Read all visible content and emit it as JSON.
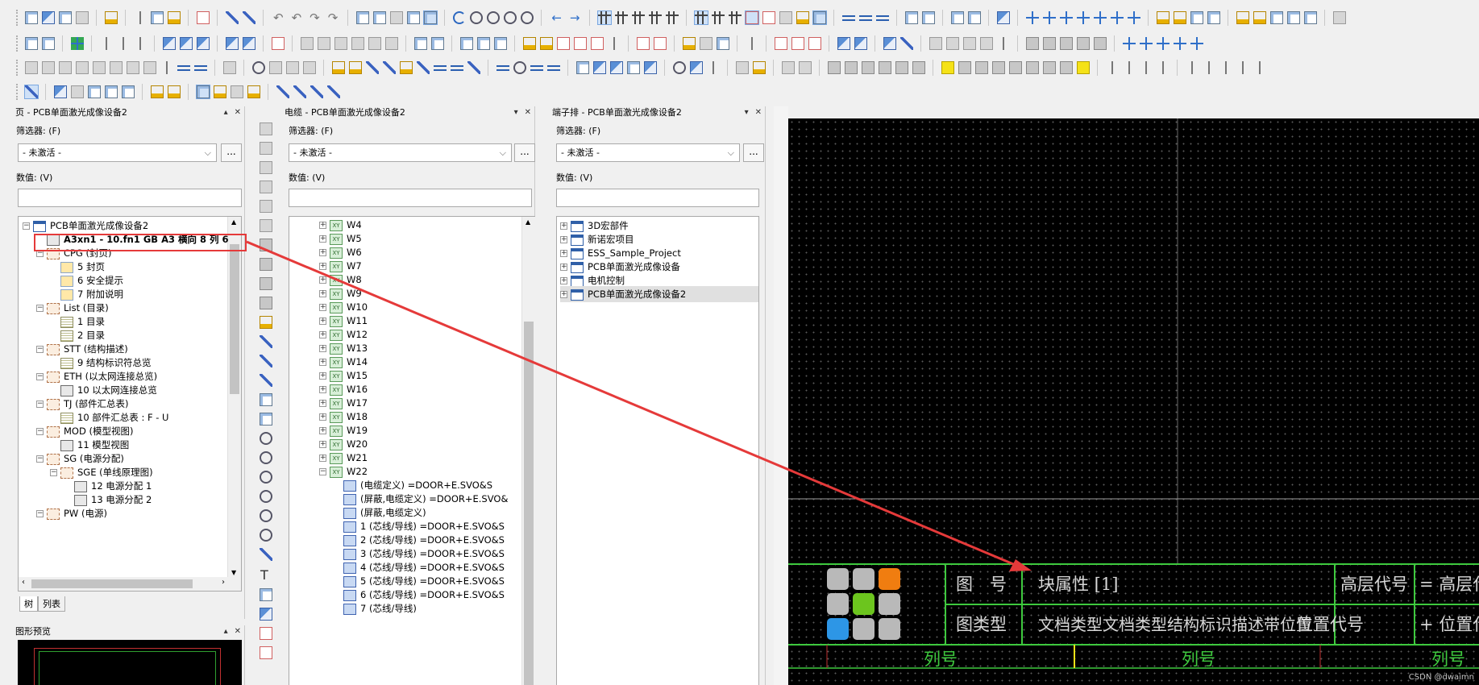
{
  "pages_panel": {
    "title": "页 - PCB单面激光成像设备2",
    "filter_label": "筛选器: (F)",
    "filter_value": "- 未激活 -",
    "value_label": "数值: (V)",
    "more_button": "...",
    "tree": [
      {
        "text": "PCB单面激光成像设备2",
        "level": 0,
        "icon": "proj",
        "exp": "−"
      },
      {
        "text": "A3xn1 - 10.fn1 GB A3 横向 8 列 6",
        "level": 1,
        "icon": "pg",
        "bold": true
      },
      {
        "text": "CPG (封页)",
        "level": 1,
        "icon": "grp",
        "exp": "−"
      },
      {
        "text": "5 封页",
        "level": 2,
        "icon": "sheet"
      },
      {
        "text": "6 安全提示",
        "level": 2,
        "icon": "sheet"
      },
      {
        "text": "7 附加说明",
        "level": 2,
        "icon": "sheet"
      },
      {
        "text": "List (目录)",
        "level": 1,
        "icon": "grp",
        "exp": "−"
      },
      {
        "text": "1 目录",
        "level": 2,
        "icon": "list"
      },
      {
        "text": "2 目录",
        "level": 2,
        "icon": "list"
      },
      {
        "text": "STT (结构描述)",
        "level": 1,
        "icon": "grp",
        "exp": "−"
      },
      {
        "text": "9 结构标识符总览",
        "level": 2,
        "icon": "list"
      },
      {
        "text": "ETH (以太网连接总览)",
        "level": 1,
        "icon": "grp",
        "exp": "−"
      },
      {
        "text": "10 以太网连接总览",
        "level": 2,
        "icon": "pg"
      },
      {
        "text": "TJ (部件汇总表)",
        "level": 1,
        "icon": "grp",
        "exp": "−"
      },
      {
        "text": "10 部件汇总表 : F - U",
        "level": 2,
        "icon": "list"
      },
      {
        "text": "MOD (模型视图)",
        "level": 1,
        "icon": "grp",
        "exp": "−"
      },
      {
        "text": "11 模型视图",
        "level": 2,
        "icon": "pg"
      },
      {
        "text": "SG (电源分配)",
        "level": 1,
        "icon": "grp",
        "exp": "−"
      },
      {
        "text": "SGE (单线原理图)",
        "level": 2,
        "icon": "grp",
        "exp": "−"
      },
      {
        "text": "12 电源分配 1",
        "level": 3,
        "icon": "pg"
      },
      {
        "text": "13 电源分配 2",
        "level": 3,
        "icon": "pg"
      },
      {
        "text": "PW (电源)",
        "level": 1,
        "icon": "grp",
        "exp": "−"
      }
    ],
    "tabs": [
      "树",
      "列表"
    ]
  },
  "preview_panel": {
    "title": "图形预览"
  },
  "cables_panel": {
    "title": "电缆 - PCB单面激光成像设备2",
    "filter_label": "筛选器: (F)",
    "filter_value": "- 未激活 -",
    "value_label": "数值: (V)",
    "more_button": "...",
    "tree": [
      {
        "text": "W4",
        "level": 0,
        "icon": "cab",
        "exp": "+"
      },
      {
        "text": "W5",
        "level": 0,
        "icon": "cab",
        "exp": "+"
      },
      {
        "text": "W6",
        "level": 0,
        "icon": "cab",
        "exp": "+"
      },
      {
        "text": "W7",
        "level": 0,
        "icon": "cab",
        "exp": "+"
      },
      {
        "text": "W8",
        "level": 0,
        "icon": "cab",
        "exp": "+"
      },
      {
        "text": "W9",
        "level": 0,
        "icon": "cab",
        "exp": "+"
      },
      {
        "text": "W10",
        "level": 0,
        "icon": "cab",
        "exp": "+"
      },
      {
        "text": "W11",
        "level": 0,
        "icon": "cab",
        "exp": "+"
      },
      {
        "text": "W12",
        "level": 0,
        "icon": "cab",
        "exp": "+"
      },
      {
        "text": "W13",
        "level": 0,
        "icon": "cab",
        "exp": "+"
      },
      {
        "text": "W14",
        "level": 0,
        "icon": "cab",
        "exp": "+"
      },
      {
        "text": "W15",
        "level": 0,
        "icon": "cab",
        "exp": "+"
      },
      {
        "text": "W16",
        "level": 0,
        "icon": "cab",
        "exp": "+"
      },
      {
        "text": "W17",
        "level": 0,
        "icon": "cab",
        "exp": "+"
      },
      {
        "text": "W18",
        "level": 0,
        "icon": "cab",
        "exp": "+"
      },
      {
        "text": "W19",
        "level": 0,
        "icon": "cab",
        "exp": "+"
      },
      {
        "text": "W20",
        "level": 0,
        "icon": "cab",
        "exp": "+"
      },
      {
        "text": "W21",
        "level": 0,
        "icon": "cab",
        "exp": "+"
      },
      {
        "text": "W22",
        "level": 0,
        "icon": "cab",
        "exp": "−"
      },
      {
        "text": "(电缆定义) =DOOR+E.SVO&S",
        "level": 1,
        "icon": "wire"
      },
      {
        "text": "(屏蔽,电缆定义) =DOOR+E.SVO&",
        "level": 1,
        "icon": "wire"
      },
      {
        "text": "(屏蔽,电缆定义)",
        "level": 1,
        "icon": "wire"
      },
      {
        "text": "1 (芯线/导线) =DOOR+E.SVO&S",
        "level": 1,
        "icon": "wire"
      },
      {
        "text": "2 (芯线/导线) =DOOR+E.SVO&S",
        "level": 1,
        "icon": "wire"
      },
      {
        "text": "3 (芯线/导线) =DOOR+E.SVO&S",
        "level": 1,
        "icon": "wire"
      },
      {
        "text": "4 (芯线/导线) =DOOR+E.SVO&S",
        "level": 1,
        "icon": "wire"
      },
      {
        "text": "5 (芯线/导线) =DOOR+E.SVO&S",
        "level": 1,
        "icon": "wire"
      },
      {
        "text": "6 (芯线/导线) =DOOR+E.SVO&S",
        "level": 1,
        "icon": "wire"
      },
      {
        "text": "7 (芯线/导线)",
        "level": 1,
        "icon": "wire"
      }
    ]
  },
  "terminal_panel": {
    "title": "端子排 - PCB单面激光成像设备2",
    "filter_label": "筛选器: (F)",
    "filter_value": "- 未激活 -",
    "value_label": "数值: (V)",
    "more_button": "...",
    "tree": [
      {
        "text": "3D宏部件",
        "level": 0,
        "icon": "proj",
        "exp": "+"
      },
      {
        "text": "新诺宏项目",
        "level": 0,
        "icon": "proj",
        "exp": "+"
      },
      {
        "text": "ESS_Sample_Project",
        "level": 0,
        "icon": "proj",
        "exp": "+"
      },
      {
        "text": "PCB单面激光成像设备",
        "level": 0,
        "icon": "proj",
        "exp": "+"
      },
      {
        "text": "电机控制",
        "level": 0,
        "icon": "proj",
        "exp": "+"
      },
      {
        "text": "PCB单面激光成像设备2",
        "level": 0,
        "icon": "proj",
        "exp": "+",
        "highlight": true
      }
    ]
  },
  "title_block": {
    "drawing_no_label": "图　号",
    "drawing_no_value": "块属性 [1]",
    "doc_type_label": "图类型",
    "doc_type_value": "文档类型文档类型结构标识描述带位置",
    "higher_code_label": "高层代号",
    "higher_code_value": "= 高层代号",
    "location_code_label": "位置代号",
    "location_code_value": "+ 位置代号",
    "column_no_label": "列号"
  },
  "colors": {
    "frame_green": "#3ec93e",
    "annotation_red": "#e53a3a",
    "logo_orange": "#f07d10",
    "logo_green": "#6cc51e",
    "logo_blue": "#2d96e6",
    "logo_grey": "#b9b9b9"
  },
  "watermark": "CSDN @dwaimn"
}
